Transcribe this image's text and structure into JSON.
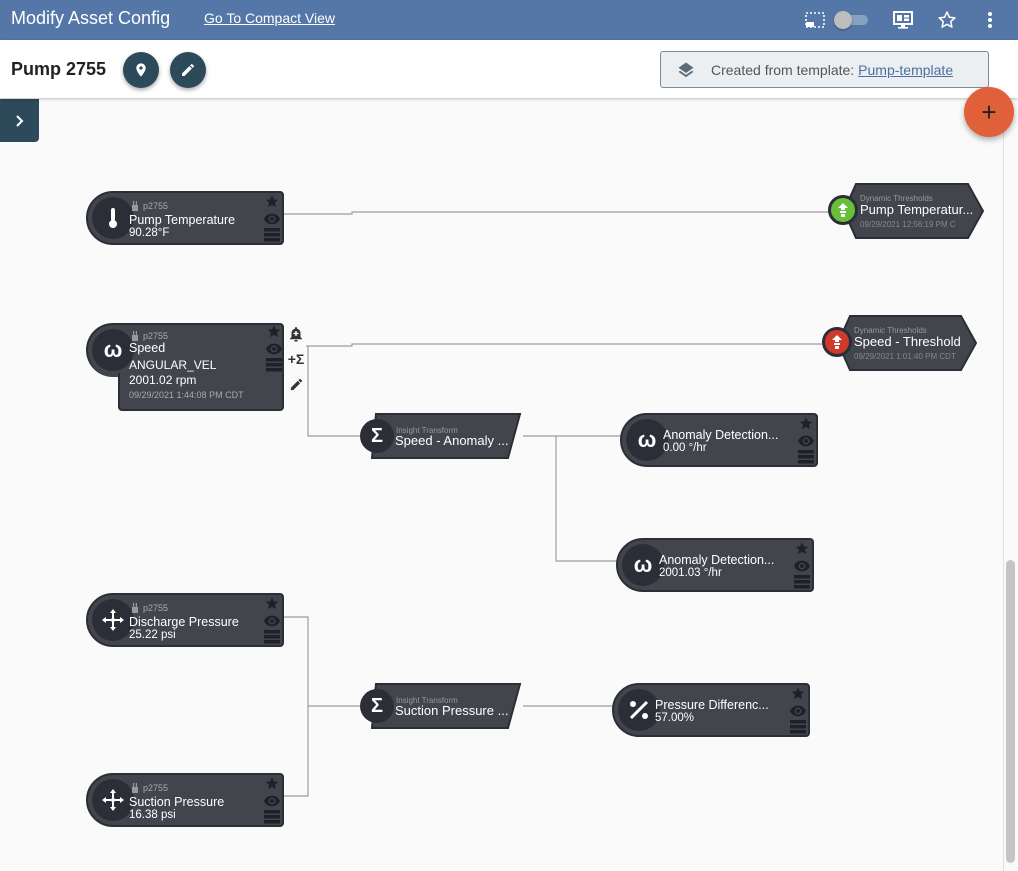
{
  "topbar": {
    "title": "Modify Asset Config",
    "compact_link": "Go To Compact View",
    "icons": [
      "selection-icon",
      "toggle-switch",
      "dashboard-monitor-icon",
      "star-icon",
      "more-vert-icon"
    ]
  },
  "subheader": {
    "asset_name": "Pump 2755",
    "buttons": [
      "location-button",
      "edit-button"
    ],
    "template_prefix": "Created from template:",
    "template_link": "Pump-template"
  },
  "fab": {
    "label": "+"
  },
  "colors": {
    "topbar": "#5577a8",
    "accent_dark": "#2d4a5a",
    "fab": "#e0603a",
    "node_bg": "#43454d",
    "status_ok": "#6abf3a",
    "status_alarm": "#d03a2c"
  },
  "nodes": {
    "pump_temp": {
      "device": "p2755",
      "title": "Pump Temperature",
      "value": "90.28°F",
      "icon": "thermometer-icon"
    },
    "speed": {
      "device": "p2755",
      "title": "Speed",
      "subtitle": "ANGULAR_VEL",
      "value": "2001.02 rpm",
      "timestamp": "09/29/2021 1:44:08 PM CDT",
      "icon": "omega-icon"
    },
    "anomaly1": {
      "title": "Anomaly Detection...",
      "value": "0.00 °/hr",
      "icon": "omega-icon"
    },
    "anomaly2": {
      "title": "Anomaly Detection...",
      "value": "2001.03 °/hr",
      "icon": "omega-icon"
    },
    "discharge": {
      "device": "p2755",
      "title": "Discharge Pressure",
      "value": "25.22 psi",
      "icon": "move-arrows-icon"
    },
    "suction": {
      "device": "p2755",
      "title": "Suction Pressure",
      "value": "16.38 psi",
      "icon": "move-arrows-icon"
    },
    "pressure_diff": {
      "title": "Pressure Differenc...",
      "value": "57.00%",
      "icon": "percent-icon"
    }
  },
  "thresholds": {
    "pump_temp": {
      "kind": "Dynamic Thresholds",
      "title": "Pump Temperatur...",
      "timestamp": "09/29/2021 12:56:19 PM C",
      "status": "ok"
    },
    "speed": {
      "kind": "Dynamic Thresholds",
      "title": "Speed - Threshold",
      "timestamp": "09/29/2021 1:01:40 PM CDT",
      "status": "alarm"
    }
  },
  "transforms": {
    "speed_anomaly": {
      "kind": "Insight Transform",
      "title": "Speed - Anomaly ..."
    },
    "suction_pressure": {
      "kind": "Insight Transform",
      "title": "Suction Pressure ..."
    }
  },
  "speed_actions": [
    "add-alert-icon",
    "add-transform-icon",
    "edit-icon"
  ]
}
